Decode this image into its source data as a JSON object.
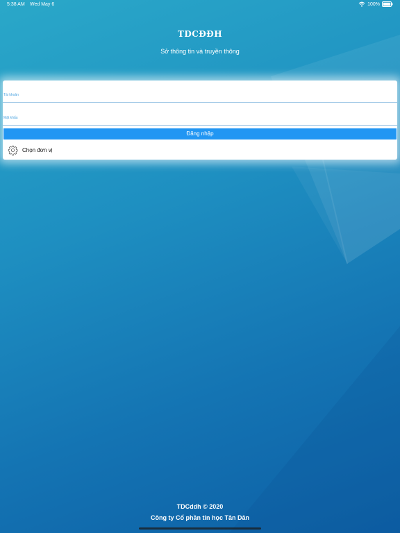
{
  "status_bar": {
    "time": "5:38 AM",
    "date": "Wed May 6",
    "battery": "100%"
  },
  "header": {
    "title": "TDCĐĐH",
    "subtitle": "Sở thông tin và truyền thông"
  },
  "login": {
    "username_label": "Tài khoản",
    "username_value": "",
    "password_label": "Mật khẩu",
    "password_value": "",
    "submit_label": "Đăng nhập",
    "unit_label": "Chọn đơn vị"
  },
  "footer": {
    "copyright": "TDCddh © 2020",
    "company": "Công ty Cổ phần tin học Tân Dân"
  },
  "colors": {
    "background_top": "#2aa8c9",
    "background_bottom": "#0d5fa5",
    "button": "#2196f3",
    "field_label": "#4aa3e0"
  },
  "icons": {
    "wifi": "wifi-icon",
    "battery": "battery-icon",
    "unit_selector": "gear-icon"
  }
}
